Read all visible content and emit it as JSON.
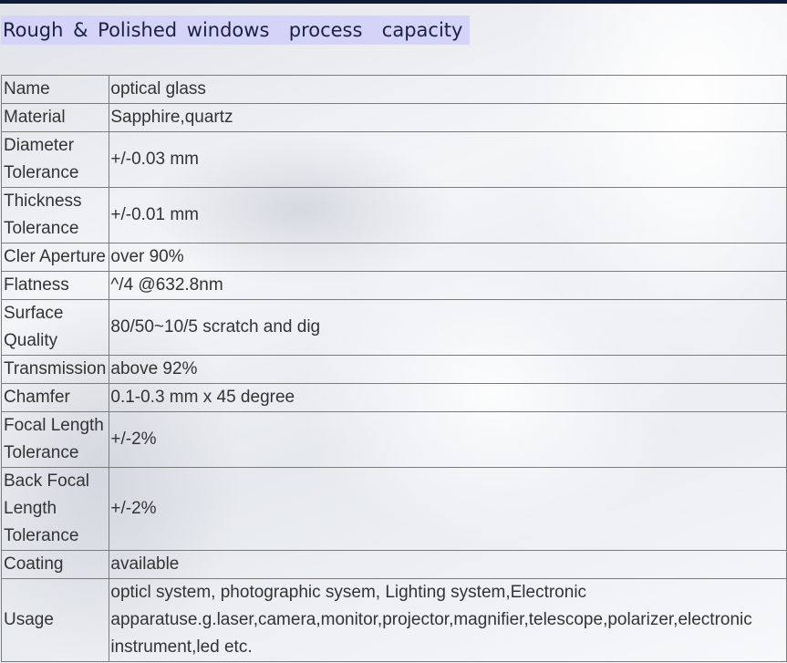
{
  "heading": "Rough & Polished windows  process  capacity",
  "rows": [
    {
      "label": "Name",
      "value": "optical glass"
    },
    {
      "label": "Material",
      "value": "Sapphire,quartz"
    },
    {
      "label": "Diameter Tolerance",
      "value": "+/-0.03 mm"
    },
    {
      "label": "Thickness Tolerance",
      "value": "+/-0.01 mm"
    },
    {
      "label": "Cler Aperture",
      "value": "over 90%"
    },
    {
      "label": "Flatness",
      "value": "^/4 @632.8nm"
    },
    {
      "label": "Surface Quality",
      "value": "80/50~10/5 scratch and dig"
    },
    {
      "label": "Transmission",
      "value": "above 92%"
    },
    {
      "label": "Chamfer",
      "value": "0.1-0.3 mm x 45 degree"
    },
    {
      "label": "Focal Length Tolerance",
      "value": "+/-2%"
    },
    {
      "label": "Back Focal Length Tolerance",
      "value": "+/-2%"
    },
    {
      "label": "Coating",
      "value": "available"
    }
  ],
  "usage": {
    "label": "Usage",
    "lines": [
      "opticl system, photographic sysem, Lighting system,Electronic",
      "apparatuse.g.laser,camera,monitor,projector,magnifier,telescope,polarizer,electronic",
      "instrument,led etc."
    ]
  }
}
